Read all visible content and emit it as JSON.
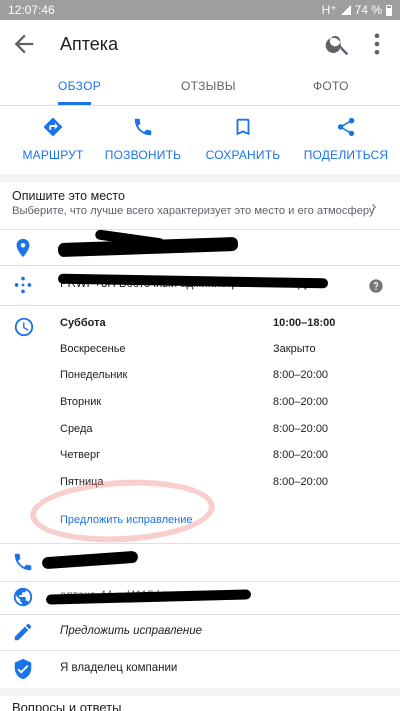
{
  "status_bar": {
    "time": "12:07:46",
    "network": "H⁺",
    "battery": "74 %"
  },
  "app_bar": {
    "title": "Аптека"
  },
  "tabs": [
    {
      "label": "ОБЗОР",
      "active": true
    },
    {
      "label": "ОТЗЫВЫ",
      "active": false
    },
    {
      "label": "ФОТО",
      "active": false
    }
  ],
  "actions": [
    {
      "label": "МАРШРУТ",
      "icon": "directions-icon"
    },
    {
      "label": "ПОЗВОНИТЬ",
      "icon": "phone-icon"
    },
    {
      "label": "СОХРАНИТЬ",
      "icon": "bookmark-icon"
    },
    {
      "label": "ПОДЕЛИТЬСЯ",
      "icon": "share-icon"
    }
  ],
  "describe": {
    "title": "Опишите это место",
    "subtitle": "Выберите, что лучше всего характеризует это место и его атмосферу"
  },
  "plus_code": {
    "text": "PRWP+3H Восточный административный округ"
  },
  "hours": {
    "rows": [
      {
        "day": "Суббота",
        "hours": "10:00–18:00",
        "bold": true
      },
      {
        "day": "Воскресенье",
        "hours": "Закрыто",
        "bold": false
      },
      {
        "day": "Понедельник",
        "hours": "8:00–20:00",
        "bold": false
      },
      {
        "day": "Вторник",
        "hours": "8:00–20:00",
        "bold": false
      },
      {
        "day": "Среда",
        "hours": "8:00–20:00",
        "bold": false
      },
      {
        "day": "Четверг",
        "hours": "8:00–20:00",
        "bold": false
      },
      {
        "day": "Пятница",
        "hours": "8:00–20:00",
        "bold": false
      }
    ],
    "suggest_edit": "Предложить исправление"
  },
  "website": {
    "text": "аптека-44.ru/4115.htm"
  },
  "suggest_edit": {
    "text": "Предложить исправление"
  },
  "owner": {
    "text": "Я владелец компании"
  },
  "qa": {
    "title": "Вопросы и ответы"
  },
  "colors": {
    "accent": "#1a73e8",
    "status_bar": "#9e9e9e",
    "divider": "#e0e0e0"
  }
}
